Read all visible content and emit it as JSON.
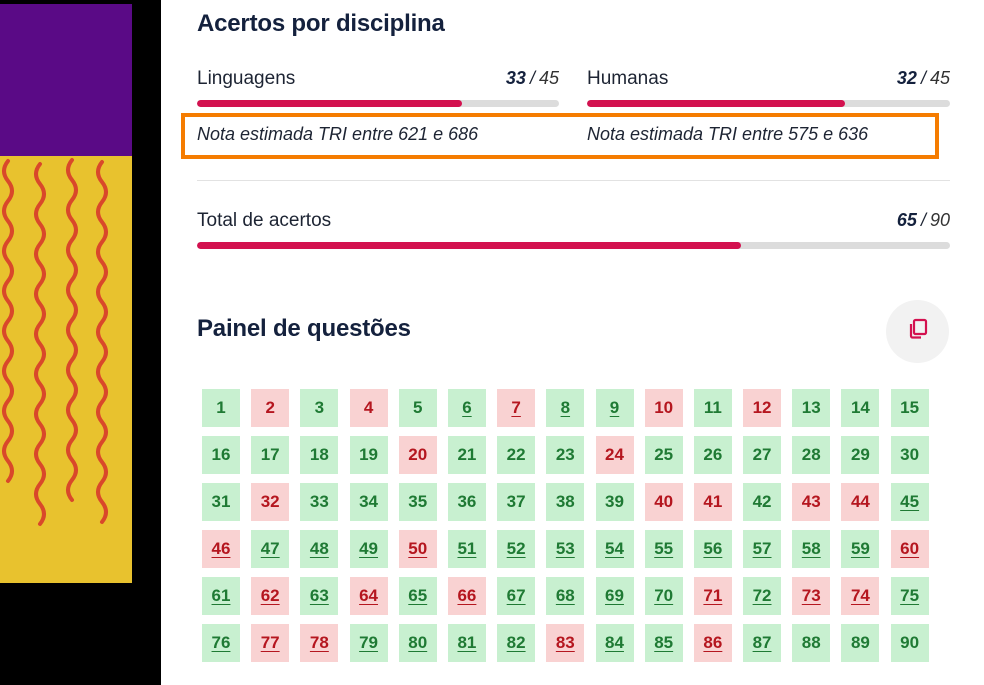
{
  "section1": {
    "title": "Acertos por disciplina",
    "subjects": [
      {
        "name": "Linguagens",
        "correct": "33",
        "total": "45",
        "fraction": 0.733,
        "nota": "Nota estimada TRI entre 621 e 686"
      },
      {
        "name": "Humanas",
        "correct": "32",
        "total": "45",
        "fraction": 0.711,
        "nota": "Nota estimada TRI entre 575 e 636"
      }
    ],
    "total": {
      "label": "Total de acertos",
      "correct": "65",
      "total": "90",
      "fraction": 0.722
    },
    "separator": "/"
  },
  "section2": {
    "title": "Painel de questões",
    "copy_icon": "copy-icon"
  },
  "questions": [
    {
      "n": "1",
      "s": "c",
      "u": false
    },
    {
      "n": "2",
      "s": "e",
      "u": false
    },
    {
      "n": "3",
      "s": "c",
      "u": false
    },
    {
      "n": "4",
      "s": "e",
      "u": false
    },
    {
      "n": "5",
      "s": "c",
      "u": false
    },
    {
      "n": "6",
      "s": "c",
      "u": true
    },
    {
      "n": "7",
      "s": "e",
      "u": true
    },
    {
      "n": "8",
      "s": "c",
      "u": true
    },
    {
      "n": "9",
      "s": "c",
      "u": true
    },
    {
      "n": "10",
      "s": "e",
      "u": false
    },
    {
      "n": "11",
      "s": "c",
      "u": false
    },
    {
      "n": "12",
      "s": "e",
      "u": false
    },
    {
      "n": "13",
      "s": "c",
      "u": false
    },
    {
      "n": "14",
      "s": "c",
      "u": false
    },
    {
      "n": "15",
      "s": "c",
      "u": false
    },
    {
      "n": "16",
      "s": "c",
      "u": false
    },
    {
      "n": "17",
      "s": "c",
      "u": false
    },
    {
      "n": "18",
      "s": "c",
      "u": false
    },
    {
      "n": "19",
      "s": "c",
      "u": false
    },
    {
      "n": "20",
      "s": "e",
      "u": false
    },
    {
      "n": "21",
      "s": "c",
      "u": false
    },
    {
      "n": "22",
      "s": "c",
      "u": false
    },
    {
      "n": "23",
      "s": "c",
      "u": false
    },
    {
      "n": "24",
      "s": "e",
      "u": false
    },
    {
      "n": "25",
      "s": "c",
      "u": false
    },
    {
      "n": "26",
      "s": "c",
      "u": false
    },
    {
      "n": "27",
      "s": "c",
      "u": false
    },
    {
      "n": "28",
      "s": "c",
      "u": false
    },
    {
      "n": "29",
      "s": "c",
      "u": false
    },
    {
      "n": "30",
      "s": "c",
      "u": false
    },
    {
      "n": "31",
      "s": "c",
      "u": false
    },
    {
      "n": "32",
      "s": "e",
      "u": false
    },
    {
      "n": "33",
      "s": "c",
      "u": false
    },
    {
      "n": "34",
      "s": "c",
      "u": false
    },
    {
      "n": "35",
      "s": "c",
      "u": false
    },
    {
      "n": "36",
      "s": "c",
      "u": false
    },
    {
      "n": "37",
      "s": "c",
      "u": false
    },
    {
      "n": "38",
      "s": "c",
      "u": false
    },
    {
      "n": "39",
      "s": "c",
      "u": false
    },
    {
      "n": "40",
      "s": "e",
      "u": false
    },
    {
      "n": "41",
      "s": "e",
      "u": false
    },
    {
      "n": "42",
      "s": "c",
      "u": false
    },
    {
      "n": "43",
      "s": "e",
      "u": false
    },
    {
      "n": "44",
      "s": "e",
      "u": false
    },
    {
      "n": "45",
      "s": "c",
      "u": true
    },
    {
      "n": "46",
      "s": "e",
      "u": true
    },
    {
      "n": "47",
      "s": "c",
      "u": true
    },
    {
      "n": "48",
      "s": "c",
      "u": true
    },
    {
      "n": "49",
      "s": "c",
      "u": true
    },
    {
      "n": "50",
      "s": "e",
      "u": true
    },
    {
      "n": "51",
      "s": "c",
      "u": true
    },
    {
      "n": "52",
      "s": "c",
      "u": true
    },
    {
      "n": "53",
      "s": "c",
      "u": true
    },
    {
      "n": "54",
      "s": "c",
      "u": true
    },
    {
      "n": "55",
      "s": "c",
      "u": true
    },
    {
      "n": "56",
      "s": "c",
      "u": true
    },
    {
      "n": "57",
      "s": "c",
      "u": true
    },
    {
      "n": "58",
      "s": "c",
      "u": true
    },
    {
      "n": "59",
      "s": "c",
      "u": true
    },
    {
      "n": "60",
      "s": "e",
      "u": true
    },
    {
      "n": "61",
      "s": "c",
      "u": true
    },
    {
      "n": "62",
      "s": "e",
      "u": true
    },
    {
      "n": "63",
      "s": "c",
      "u": true
    },
    {
      "n": "64",
      "s": "e",
      "u": true
    },
    {
      "n": "65",
      "s": "c",
      "u": true
    },
    {
      "n": "66",
      "s": "e",
      "u": true
    },
    {
      "n": "67",
      "s": "c",
      "u": true
    },
    {
      "n": "68",
      "s": "c",
      "u": true
    },
    {
      "n": "69",
      "s": "c",
      "u": true
    },
    {
      "n": "70",
      "s": "c",
      "u": true
    },
    {
      "n": "71",
      "s": "e",
      "u": true
    },
    {
      "n": "72",
      "s": "c",
      "u": true
    },
    {
      "n": "73",
      "s": "e",
      "u": true
    },
    {
      "n": "74",
      "s": "e",
      "u": true
    },
    {
      "n": "75",
      "s": "c",
      "u": true
    },
    {
      "n": "76",
      "s": "c",
      "u": true
    },
    {
      "n": "77",
      "s": "e",
      "u": true
    },
    {
      "n": "78",
      "s": "e",
      "u": true
    },
    {
      "n": "79",
      "s": "c",
      "u": true
    },
    {
      "n": "80",
      "s": "c",
      "u": true
    },
    {
      "n": "81",
      "s": "c",
      "u": true
    },
    {
      "n": "82",
      "s": "c",
      "u": true
    },
    {
      "n": "83",
      "s": "e",
      "u": true
    },
    {
      "n": "84",
      "s": "c",
      "u": true
    },
    {
      "n": "85",
      "s": "c",
      "u": true
    },
    {
      "n": "86",
      "s": "e",
      "u": true
    },
    {
      "n": "87",
      "s": "c",
      "u": true
    },
    {
      "n": "88",
      "s": "c",
      "u": false
    },
    {
      "n": "89",
      "s": "c",
      "u": false
    },
    {
      "n": "90",
      "s": "c",
      "u": false
    }
  ],
  "colors": {
    "accent": "#d3114f",
    "highlight": "#f57c00",
    "correct_bg": "#c8f0d0",
    "wrong_bg": "#f9d2d2",
    "side_purple": "#5a0a86",
    "side_yellow": "#e8c22e"
  }
}
